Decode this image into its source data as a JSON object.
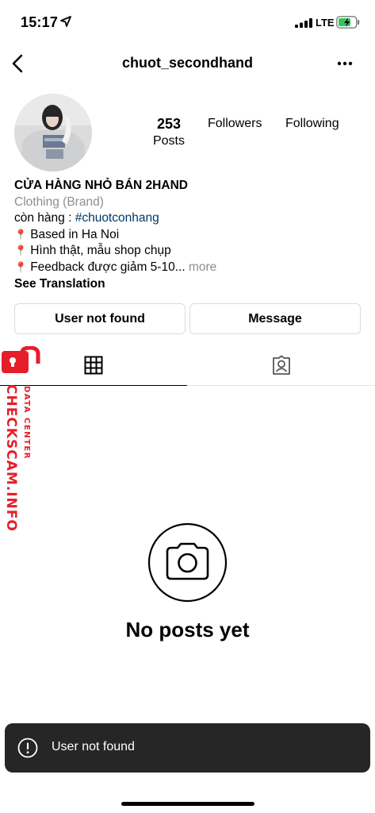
{
  "status_bar": {
    "time": "15:17",
    "network": "LTE"
  },
  "header": {
    "username": "chuot_secondhand"
  },
  "stats": {
    "posts_count": "253",
    "posts_label": "Posts",
    "followers_label": "Followers",
    "following_label": "Following"
  },
  "bio": {
    "name": "CỬA HÀNG NHỎ BÁN 2HAND",
    "category": "Clothing (Brand)",
    "line1_prefix": "còn hàng : ",
    "hashtag": "#chuotconhang",
    "line2": "Based in Ha Noi",
    "line3": "Hình thật, mẫu shop chụp",
    "line4": "Feedback được giảm 5-10...",
    "more": " more",
    "see_translation": "See Translation"
  },
  "buttons": {
    "user": "User not found",
    "message": "Message"
  },
  "watermark": {
    "main": "CHECKSCAM.INFO",
    "sub": "DATA CENTER"
  },
  "empty_state": {
    "title": "No posts yet"
  },
  "toast": {
    "message": "User not found"
  },
  "colors": {
    "watermark_red": "#e51e2a",
    "hashtag_blue": "#00376b",
    "toast_bg": "#262626"
  },
  "icons": [
    "back-icon",
    "more-icon",
    "grid-icon",
    "tagged-icon",
    "camera-icon",
    "alert-icon",
    "lock-icon",
    "location-arrow-icon",
    "signal-icon",
    "battery-icon"
  ]
}
